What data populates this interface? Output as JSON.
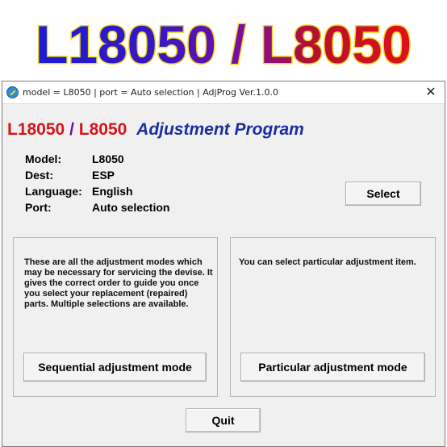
{
  "banner": {
    "text": "L18050 / L8050"
  },
  "window": {
    "title": "model = L8050 | port = Auto selection | AdjProg Ver.1.0.0",
    "close_glyph": "✕",
    "app_icon": "adjprog-app-icon"
  },
  "program_title": {
    "model_a": "L18050",
    "separator": "/",
    "model_b": "L8050",
    "subtitle": "Adjustment Program"
  },
  "info": [
    {
      "key": "Model:",
      "value": "L8050"
    },
    {
      "key": "Dest:",
      "value": "ESP"
    },
    {
      "key": "Language:",
      "value": "English"
    },
    {
      "key": "Port:",
      "value": "Auto selection"
    }
  ],
  "buttons": {
    "select": "Select",
    "sequential": "Sequential adjustment mode",
    "particular": "Particular adjustment mode",
    "quit": "Quit"
  },
  "panels": {
    "left_description": "These are all the adjustment modes which may be necessary for servicing the devise. It gives the correct order to guide you once you select your replacement (repaired) parts. Multiple selections are available.",
    "right_description": "You can select particular adjustment item."
  },
  "colors": {
    "banner_gradient": [
      "#1b1bd8",
      "#7a0f9e",
      "#c8101e",
      "#e0101a"
    ],
    "banner_outline": "#f5d61a",
    "title_red": "#d8141b",
    "title_blue": "#1a2f9c"
  }
}
